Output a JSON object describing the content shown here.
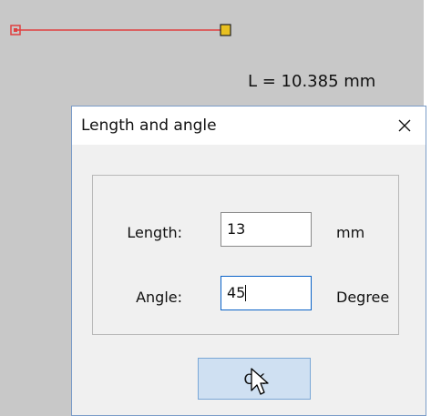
{
  "measurement": {
    "readout": "L = 10.385 mm",
    "line_color": "#e04040",
    "start_handle_color": "#e04040",
    "end_handle_color": "#c8a000"
  },
  "dialog": {
    "title": "Length and angle",
    "close_label": "X",
    "fields": [
      {
        "label": "Length:",
        "value": "13",
        "unit": "mm"
      },
      {
        "label": "Angle:",
        "value": "45",
        "unit": "Degree"
      }
    ],
    "ok_label": "OK"
  },
  "colors": {
    "canvas": "#c8c8c8",
    "dialog_bg": "#f0f0f0",
    "focus": "#0a63c8",
    "ok_button": "#cfe0f2"
  },
  "icons": {
    "close": "close-icon",
    "cursor": "mouse-pointer-icon"
  }
}
